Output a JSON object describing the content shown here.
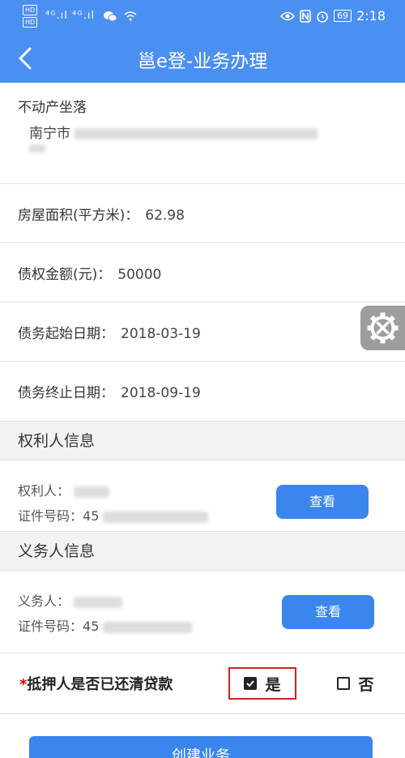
{
  "status_bar": {
    "hd_top": "HD",
    "hd_bottom": "HD",
    "signal": "⁴ᴳ.ıl ⁴ᴳ.ıl",
    "battery": "69",
    "time": "2:18"
  },
  "appbar": {
    "title": "邕e登-业务办理"
  },
  "property": {
    "location_label": "不动产坐落",
    "location_value": "南宁市",
    "area_label": "房屋面积(平方米)：",
    "area_value": "62.98",
    "debt_amount_label": "债权金额(元)：",
    "debt_amount_value": "50000",
    "start_date_label": "债务起始日期：",
    "start_date_value": "2018-03-19",
    "end_date_label": "债务终止日期：",
    "end_date_value": "2018-09-19"
  },
  "rights_holder": {
    "section_title": "权利人信息",
    "name_label": "权利人：",
    "id_label": "证件号码：",
    "id_prefix": "45",
    "view_button": "查看"
  },
  "obligor": {
    "section_title": "义务人信息",
    "name_label": "义务人：",
    "id_label": "证件号码：",
    "id_prefix": "45",
    "view_button": "查看"
  },
  "mortgage": {
    "required_mark": "*",
    "question": "抵押人是否已还清贷款",
    "yes_label": "是",
    "no_label": "否",
    "selected": "yes"
  },
  "create_button": "创建业务"
}
